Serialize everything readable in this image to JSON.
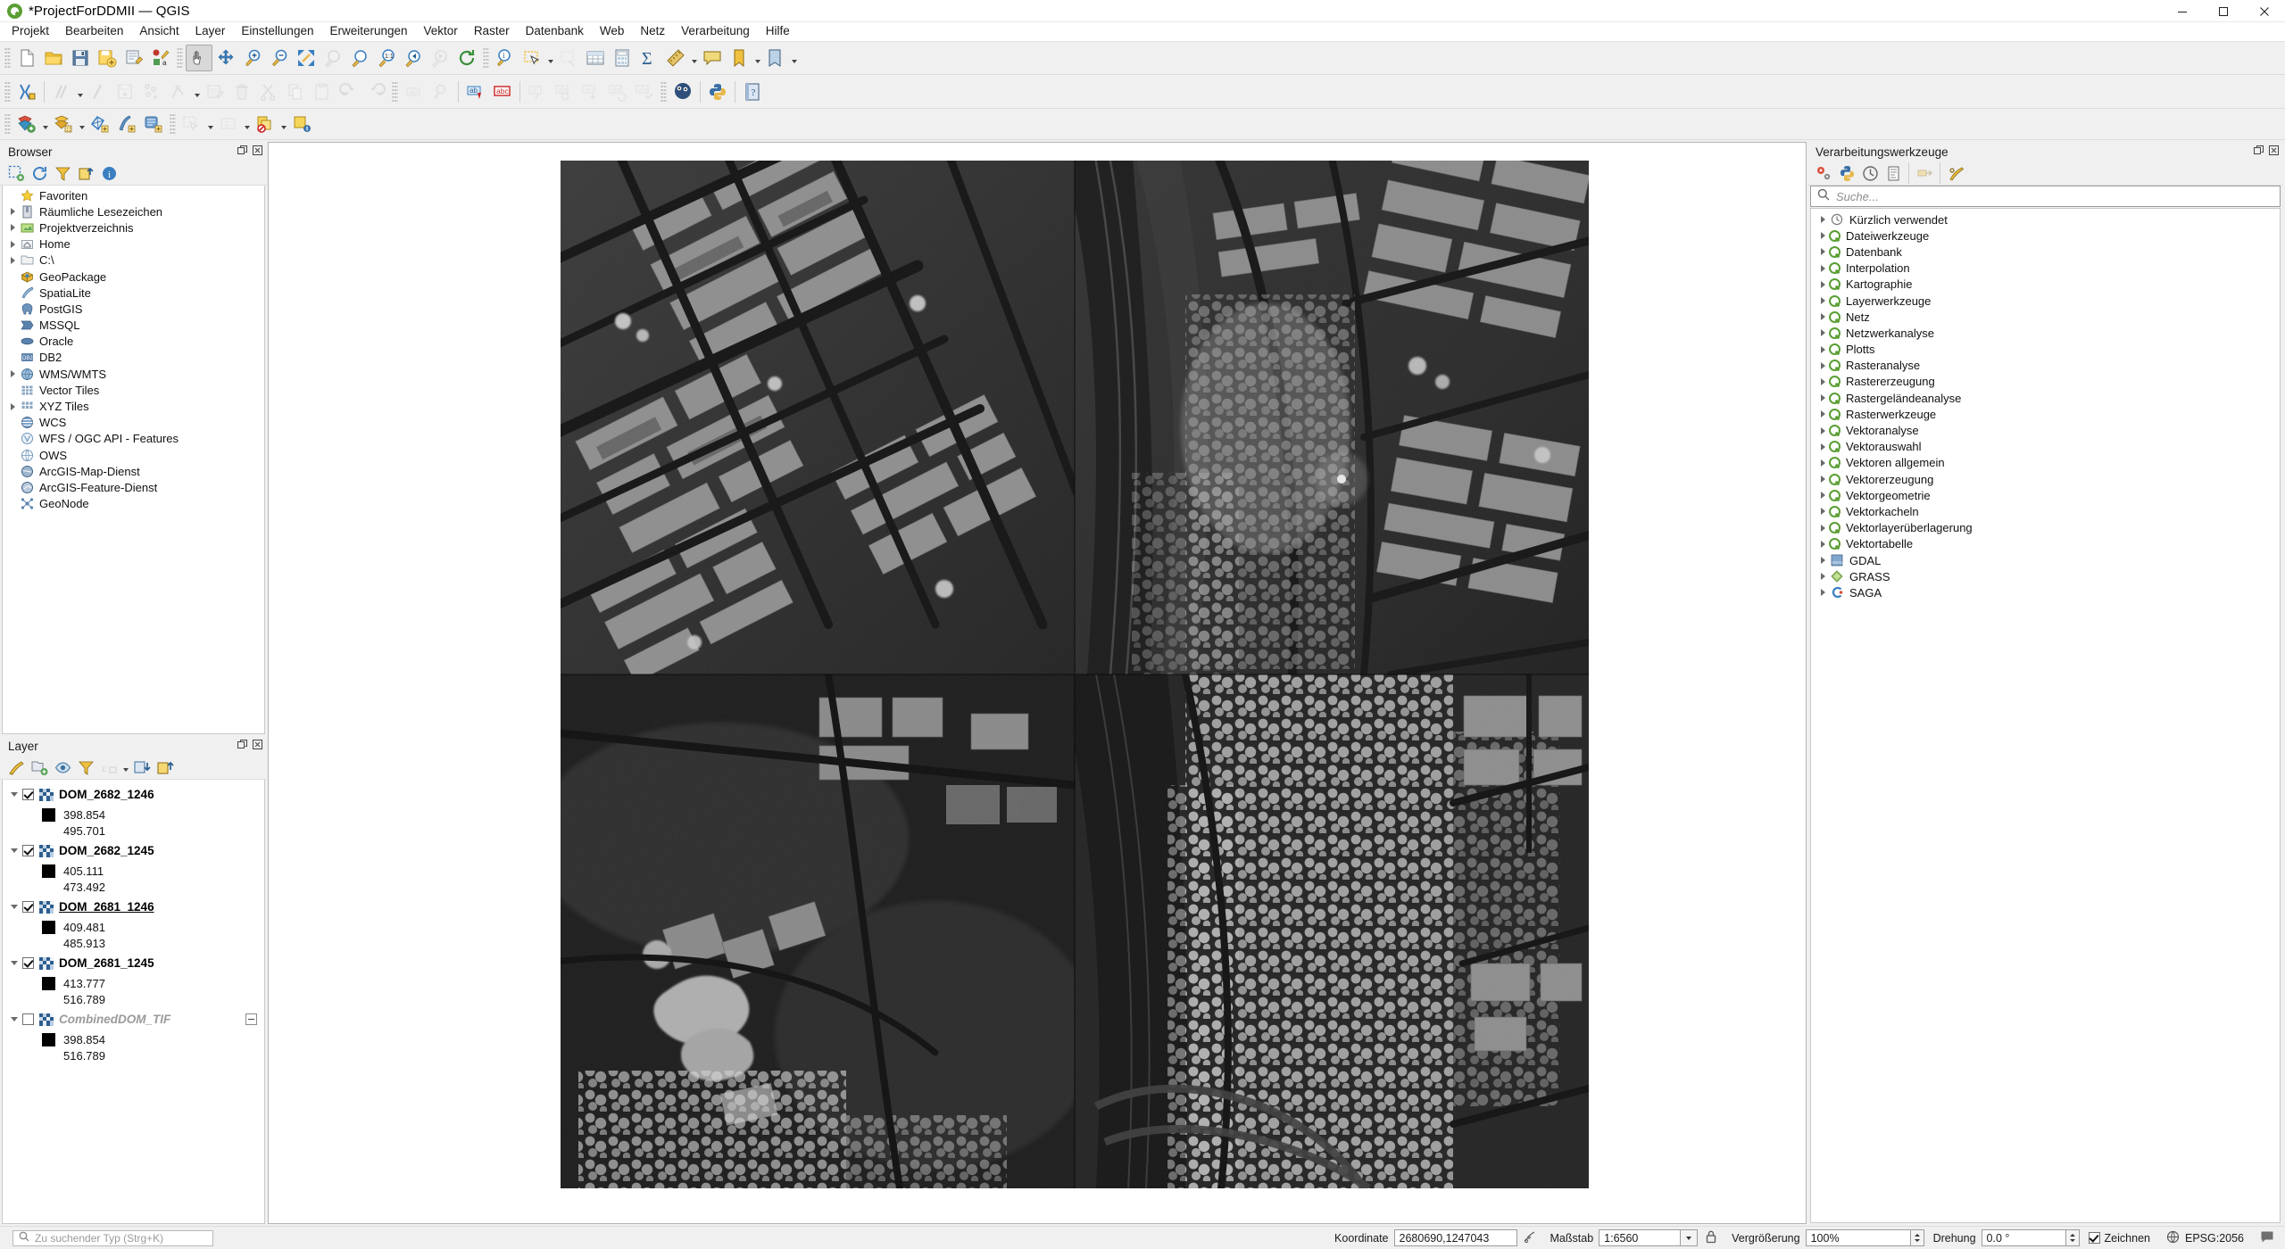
{
  "window": {
    "title": "*ProjectForDDMII — QGIS",
    "logo_icon": "qgis-logo-icon",
    "minimize_label": "Minimieren",
    "maximize_label": "Maximieren",
    "close_label": "Schließen"
  },
  "menubar": {
    "items": [
      {
        "label": "Projekt"
      },
      {
        "label": "Bearbeiten"
      },
      {
        "label": "Ansicht"
      },
      {
        "label": "Layer"
      },
      {
        "label": "Einstellungen"
      },
      {
        "label": "Erweiterungen"
      },
      {
        "label": "Vektor"
      },
      {
        "label": "Raster"
      },
      {
        "label": "Datenbank"
      },
      {
        "label": "Web"
      },
      {
        "label": "Netz"
      },
      {
        "label": "Verarbeitung"
      },
      {
        "label": "Hilfe"
      }
    ]
  },
  "toolbar_row1": {
    "icons": [
      "new-project-icon",
      "open-project-icon",
      "save-project-icon",
      "save-project-as-icon",
      "new-print-layout-icon",
      "style-manager-icon",
      "pan-map-icon",
      "pan-to-selection-icon",
      "zoom-in-icon",
      "zoom-out-icon",
      "zoom-full-icon",
      "zoom-to-selection-icon",
      "zoom-to-layer-icon",
      "zoom-native-icon",
      "zoom-last-icon",
      "zoom-next-icon",
      "refresh-icon",
      "identify-features-icon",
      "select-features-icon",
      "deselect-icon",
      "open-attribute-table-icon",
      "field-calculator-icon",
      "statistics-icon",
      "measure-icon",
      "map-tips-icon",
      "new-bookmark-icon",
      "show-bookmarks-icon",
      "text-annotation-icon"
    ]
  },
  "toolbar_row2": {
    "icons": [
      "current-edits-icon",
      "digitizing-toggle-icon",
      "add-feature-icon",
      "move-feature-icon",
      "node-tool-icon",
      "vertex-tool-icon",
      "modify-attributes-icon",
      "delete-selected-icon",
      "cut-features-icon",
      "copy-features-icon",
      "paste-features-icon",
      "undo-icon",
      "redo-icon",
      "label-toolbar-icon",
      "pin-labels-icon",
      "highlight-labels-icon",
      "show-hide-labels-icon",
      "move-label-icon",
      "rotate-label-icon",
      "change-label-icon",
      "move-label-diagram-icon",
      "pin-label-diagram-icon",
      "python-console-icon",
      "help-icon"
    ]
  },
  "toolbar_row3": {
    "icons": [
      "add-vector-layer-icon",
      "add-raster-layer-icon",
      "add-mesh-layer-icon",
      "add-delimited-text-icon",
      "add-postgis-layer-icon",
      "add-spatialite-layer-icon",
      "add-wms-layer-icon",
      "add-wcs-layer-icon",
      "add-wfs-layer-icon",
      "select-features-by-area-icon",
      "open-table-icon",
      "new-virtual-layer-icon",
      "open-field-calculator-icon"
    ]
  },
  "browser_panel": {
    "title": "Browser",
    "toolbar_icons": [
      "add-layer-icon",
      "refresh-icon",
      "filter-browser-icon",
      "collapse-all-icon",
      "properties-info-icon"
    ],
    "items": [
      {
        "label": "Favoriten",
        "icon": "favorites-star-icon",
        "expandable": false
      },
      {
        "label": "Räumliche Lesezeichen",
        "icon": "spatial-bookmarks-icon",
        "expandable": true
      },
      {
        "label": "Projektverzeichnis",
        "icon": "project-home-icon",
        "expandable": true
      },
      {
        "label": "Home",
        "icon": "home-folder-icon",
        "expandable": true
      },
      {
        "label": "C:\\",
        "icon": "drive-folder-icon",
        "expandable": true
      },
      {
        "label": "GeoPackage",
        "icon": "geopackage-icon",
        "expandable": false
      },
      {
        "label": "SpatiaLite",
        "icon": "spatialite-icon",
        "expandable": false
      },
      {
        "label": "PostGIS",
        "icon": "postgis-elephant-icon",
        "expandable": false
      },
      {
        "label": "MSSQL",
        "icon": "mssql-icon",
        "expandable": false
      },
      {
        "label": "Oracle",
        "icon": "oracle-icon",
        "expandable": false
      },
      {
        "label": "DB2",
        "icon": "db2-icon",
        "expandable": false
      },
      {
        "label": "WMS/WMTS",
        "icon": "wms-globe-icon",
        "expandable": true
      },
      {
        "label": "Vector Tiles",
        "icon": "vector-tiles-grid-icon",
        "expandable": false
      },
      {
        "label": "XYZ Tiles",
        "icon": "xyz-tiles-grid-icon",
        "expandable": true
      },
      {
        "label": "WCS",
        "icon": "wcs-globe-icon",
        "expandable": false
      },
      {
        "label": "WFS / OGC API - Features",
        "icon": "wfs-globe-icon",
        "expandable": false
      },
      {
        "label": "OWS",
        "icon": "ows-globe-icon",
        "expandable": false
      },
      {
        "label": "ArcGIS-Map-Dienst",
        "icon": "arcgis-map-service-icon",
        "expandable": false
      },
      {
        "label": "ArcGIS-Feature-Dienst",
        "icon": "arcgis-feature-service-icon",
        "expandable": false
      },
      {
        "label": "GeoNode",
        "icon": "geonode-icon",
        "expandable": false
      }
    ]
  },
  "layer_panel": {
    "title": "Layer",
    "toolbar_icons": [
      "open-layer-styling-icon",
      "add-group-icon",
      "manage-visibility-icon",
      "filter-legend-icon",
      "expression-filter-icon",
      "expand-all-icon",
      "collapse-all-icon",
      "remove-layer-icon"
    ],
    "layers": [
      {
        "name": "DOM_2682_1246",
        "checked": true,
        "selected": false,
        "min": "398.854",
        "max": "495.701",
        "icon": "raster-layer-icon"
      },
      {
        "name": "DOM_2682_1245",
        "checked": true,
        "selected": false,
        "min": "405.111",
        "max": "473.492",
        "icon": "raster-layer-icon"
      },
      {
        "name": "DOM_2681_1246",
        "checked": true,
        "selected": true,
        "min": "409.481",
        "max": "485.913",
        "icon": "raster-layer-icon"
      },
      {
        "name": "DOM_2681_1245",
        "checked": true,
        "selected": false,
        "min": "413.777",
        "max": "516.789",
        "icon": "raster-layer-icon"
      },
      {
        "name": "CombinedDOM_TIF",
        "checked": false,
        "selected": false,
        "min": "398.854",
        "max": "516.789",
        "icon": "raster-layer-icon"
      }
    ]
  },
  "processing_panel": {
    "title": "Verarbeitungswerkzeuge",
    "toolbar_icons": [
      "processing-options-icon",
      "python-script-icon",
      "history-icon",
      "processing-log-icon",
      "model-designer-icon",
      "edit-model-icon"
    ],
    "search": {
      "placeholder": "Suche...",
      "value": "",
      "icon": "search-icon"
    },
    "groups": [
      {
        "label": "Kürzlich verwendet",
        "icon": "recent-clock-icon"
      },
      {
        "label": "Dateiwerkzeuge",
        "icon": "qgis-provider-icon"
      },
      {
        "label": "Datenbank",
        "icon": "qgis-provider-icon"
      },
      {
        "label": "Interpolation",
        "icon": "qgis-provider-icon"
      },
      {
        "label": "Kartographie",
        "icon": "qgis-provider-icon"
      },
      {
        "label": "Layerwerkzeuge",
        "icon": "qgis-provider-icon"
      },
      {
        "label": "Netz",
        "icon": "qgis-provider-icon"
      },
      {
        "label": "Netzwerkanalyse",
        "icon": "qgis-provider-icon"
      },
      {
        "label": "Plotts",
        "icon": "qgis-provider-icon"
      },
      {
        "label": "Rasteranalyse",
        "icon": "qgis-provider-icon"
      },
      {
        "label": "Rastererzeugung",
        "icon": "qgis-provider-icon"
      },
      {
        "label": "Rastergeländeanalyse",
        "icon": "qgis-provider-icon"
      },
      {
        "label": "Rasterwerkzeuge",
        "icon": "qgis-provider-icon"
      },
      {
        "label": "Vektoranalyse",
        "icon": "qgis-provider-icon"
      },
      {
        "label": "Vektorauswahl",
        "icon": "qgis-provider-icon"
      },
      {
        "label": "Vektoren allgemein",
        "icon": "qgis-provider-icon"
      },
      {
        "label": "Vektorerzeugung",
        "icon": "qgis-provider-icon"
      },
      {
        "label": "Vektorgeometrie",
        "icon": "qgis-provider-icon"
      },
      {
        "label": "Vektorkacheln",
        "icon": "qgis-provider-icon"
      },
      {
        "label": "Vektorlayerüberlagerung",
        "icon": "qgis-provider-icon"
      },
      {
        "label": "Vektortabelle",
        "icon": "qgis-provider-icon"
      },
      {
        "label": "GDAL",
        "icon": "gdal-icon"
      },
      {
        "label": "GRASS",
        "icon": "grass-icon"
      },
      {
        "label": "SAGA",
        "icon": "saga-icon"
      }
    ]
  },
  "statusbar": {
    "locator_placeholder": "Zu suchender Typ (Strg+K)",
    "coordinate_label": "Koordinate",
    "coordinate_value": "2680690,1247043",
    "scale_label": "Maßstab",
    "scale_value": "1:6560",
    "magnifier_label": "Vergrößerung",
    "magnifier_value": "100%",
    "rotation_label": "Drehung",
    "rotation_value": "0.0 °",
    "render_label": "Zeichnen",
    "render_checked": true,
    "crs_label": "EPSG:2056",
    "lock_icon": "lock-scale-icon",
    "crs_icon": "crs-globe-icon",
    "messages_icon": "messages-bubble-icon",
    "coordinate_toggle_icon": "coordinate-capture-icon"
  }
}
